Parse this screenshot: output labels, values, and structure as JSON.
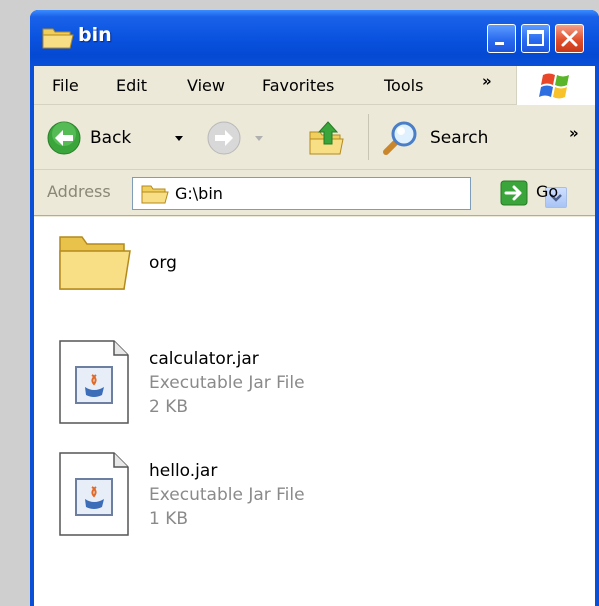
{
  "window": {
    "title": "bin"
  },
  "menu": {
    "items": [
      "File",
      "Edit",
      "View",
      "Favorites",
      "Tools"
    ],
    "chevron": "»"
  },
  "toolbar": {
    "back_label": "Back",
    "search_label": "Search",
    "chevron": "»"
  },
  "address": {
    "label": "Address",
    "value": "G:\\bin",
    "go_label": "Go"
  },
  "files": [
    {
      "name": "org",
      "icon": "folder-icon"
    },
    {
      "name": "calculator.jar",
      "type": "Executable Jar File",
      "size": "2 KB",
      "icon": "jar-file-icon"
    },
    {
      "name": "hello.jar",
      "type": "Executable Jar File",
      "size": "1 KB",
      "icon": "jar-file-icon"
    }
  ],
  "colors": {
    "titlebar": "#0a53e0",
    "chrome": "#ece9d8",
    "close_button": "#e0502c"
  }
}
